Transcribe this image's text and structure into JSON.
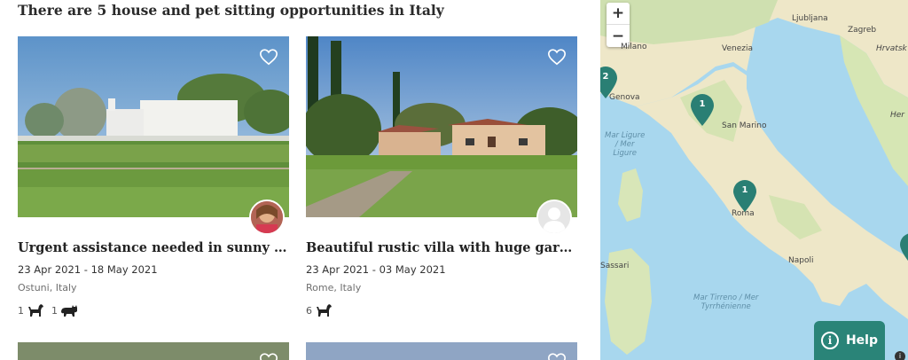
{
  "heading": "There are 5 house and pet sitting opportunities in Italy",
  "listings": [
    {
      "title": "Urgent assistance needed in sunny south...",
      "dates": "23 Apr 2021 - 18 May 2021",
      "location": "Ostuni, Italy",
      "pets": [
        {
          "count": "1",
          "icon": "dog-icon"
        },
        {
          "count": "1",
          "icon": "cat-icon"
        }
      ]
    },
    {
      "title": "Beautiful rustic villa with huge garden a...",
      "dates": "23 Apr 2021 - 03 May 2021",
      "location": "Rome, Italy",
      "pets": [
        {
          "count": "6",
          "icon": "dog-icon"
        }
      ]
    }
  ],
  "map": {
    "zoom_in": "+",
    "zoom_out": "−",
    "labels": {
      "milano": "Milano",
      "ljubljana": "Ljubljana",
      "zagreb": "Zagreb",
      "venezia": "Venezia",
      "hrvatska": "Hrvatsk",
      "her": "Her",
      "genova": "Genova",
      "san_marino": "San Marino",
      "mar_ligure_1": "Mar Ligure",
      "mar_ligure_2": "/ Mer",
      "mar_ligure_3": "Ligure",
      "roma": "Roma",
      "napoli": "Napoli",
      "sassari": "Sassari",
      "tirreno_1": "Mar Tirreno / Mer",
      "tirreno_2": "Tyrrhénienne"
    },
    "markers": [
      "2",
      "1",
      "1"
    ],
    "marker_color": "#2a7f74"
  },
  "help_label": "Help",
  "accent": "#2a8478"
}
